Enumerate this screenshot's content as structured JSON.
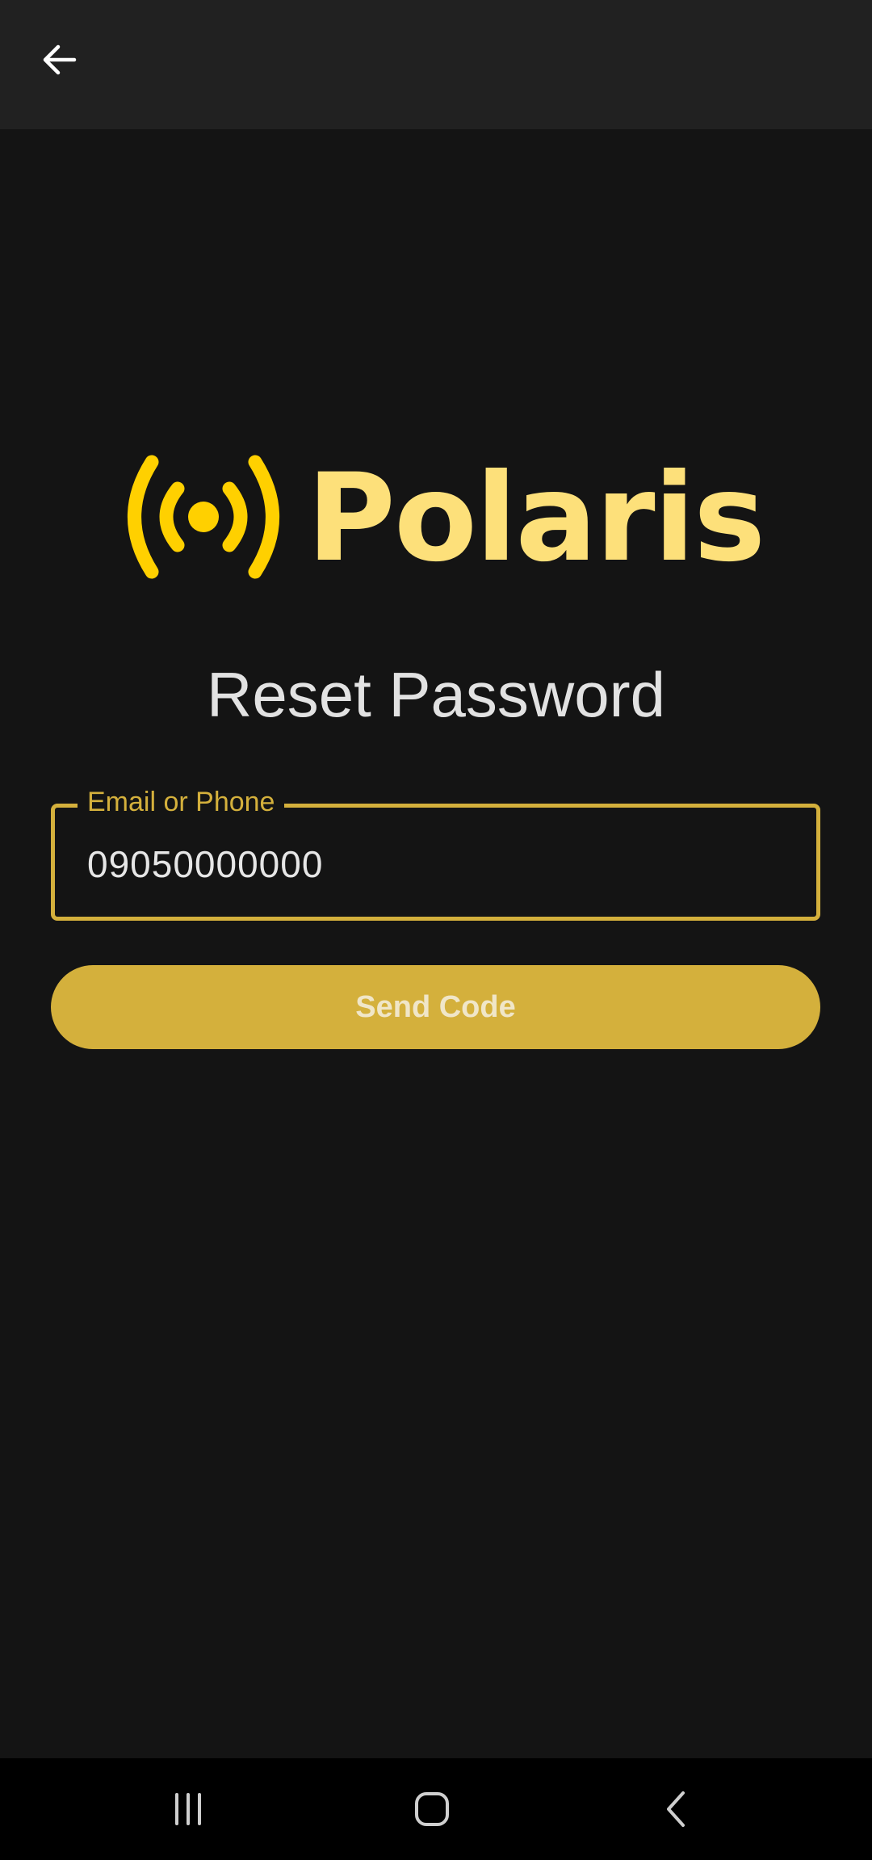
{
  "app_bar": {
    "back_icon": "arrow-left-icon"
  },
  "logo": {
    "icon": "broadcast-signal-icon",
    "text": "Polaris",
    "icon_color": "#ffd000",
    "text_color": "#fde07a"
  },
  "page": {
    "title": "Reset Password"
  },
  "form": {
    "field_label": "Email or Phone",
    "field_value": "09050000000",
    "accent_color": "#d4b03c",
    "submit_label": "Send Code"
  },
  "system_nav": {
    "recents_icon": "recent-apps-icon",
    "home_icon": "home-icon",
    "back_icon": "back-chevron-icon"
  }
}
